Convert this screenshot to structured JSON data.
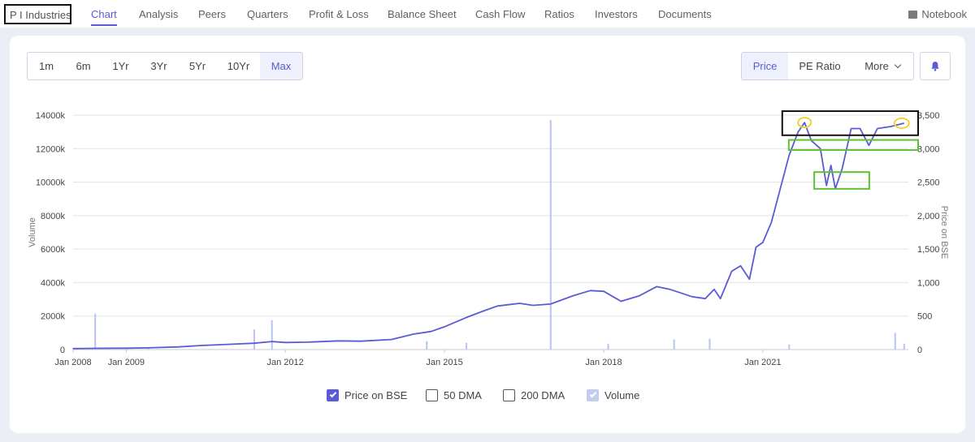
{
  "nav": {
    "company": "P I Industries",
    "items": [
      "Chart",
      "Analysis",
      "Peers",
      "Quarters",
      "Profit & Loss",
      "Balance Sheet",
      "Cash Flow",
      "Ratios",
      "Investors",
      "Documents"
    ],
    "active": "Chart",
    "notebook": "Notebook"
  },
  "ranges": {
    "items": [
      "1m",
      "6m",
      "1Yr",
      "3Yr",
      "5Yr",
      "10Yr",
      "Max"
    ],
    "selected": "Max"
  },
  "metrics": {
    "price": "Price",
    "pe": "PE Ratio",
    "more": "More",
    "selected": "Price"
  },
  "icons": {
    "notebook": "book-icon",
    "alert": "bell-icon",
    "dropdown": "chevron-down-icon"
  },
  "colors": {
    "accent": "#5a5bd5",
    "price_line": "#5a5bd5",
    "volume": "#b7c4ef",
    "annotation_box": "#111111",
    "annotation_green": "#5bc236",
    "annotation_circle": "#f0d23a"
  },
  "legend": [
    {
      "label": "Price on BSE",
      "checked": true
    },
    {
      "label": "50 DMA",
      "checked": false
    },
    {
      "label": "200 DMA",
      "checked": false
    },
    {
      "label": "Volume",
      "checked": true
    }
  ],
  "chart_data": {
    "type": "line",
    "title": "",
    "x_tick_labels": [
      "Jan 2008",
      "Jan 2009",
      "Jan 2012",
      "Jan 2015",
      "Jan 2018",
      "Jan 2021"
    ],
    "y_left": {
      "label": "Volume",
      "ticks": [
        "0",
        "2000k",
        "4000k",
        "6000k",
        "8000k",
        "10000k",
        "12000k",
        "14000k"
      ],
      "range": [
        0,
        14000
      ]
    },
    "y_right": {
      "label": "Price on BSE",
      "ticks": [
        "0",
        "500",
        "1,000",
        "1,500",
        "2,000",
        "2,500",
        "3,000",
        "3,500"
      ],
      "range": [
        0,
        3500
      ]
    },
    "grid": true,
    "x_range": [
      "2008-01-01",
      "2023-09-30"
    ],
    "series": [
      {
        "name": "Price on BSE",
        "axis": "right",
        "points": [
          [
            "2008-01-01",
            15
          ],
          [
            "2008-06-01",
            18
          ],
          [
            "2009-01-01",
            20
          ],
          [
            "2009-06-01",
            25
          ],
          [
            "2010-01-01",
            40
          ],
          [
            "2010-06-01",
            60
          ],
          [
            "2011-01-01",
            80
          ],
          [
            "2011-06-01",
            95
          ],
          [
            "2011-10-01",
            120
          ],
          [
            "2012-01-01",
            105
          ],
          [
            "2012-06-01",
            110
          ],
          [
            "2013-01-01",
            130
          ],
          [
            "2013-06-01",
            125
          ],
          [
            "2014-01-01",
            150
          ],
          [
            "2014-06-01",
            230
          ],
          [
            "2014-10-01",
            270
          ],
          [
            "2015-01-01",
            340
          ],
          [
            "2015-06-01",
            480
          ],
          [
            "2015-10-01",
            580
          ],
          [
            "2016-01-01",
            650
          ],
          [
            "2016-06-01",
            690
          ],
          [
            "2016-09-01",
            660
          ],
          [
            "2017-01-01",
            680
          ],
          [
            "2017-06-01",
            800
          ],
          [
            "2017-10-01",
            880
          ],
          [
            "2018-01-01",
            870
          ],
          [
            "2018-05-01",
            720
          ],
          [
            "2018-09-01",
            800
          ],
          [
            "2019-01-01",
            940
          ],
          [
            "2019-04-01",
            900
          ],
          [
            "2019-09-01",
            790
          ],
          [
            "2019-12-01",
            760
          ],
          [
            "2020-02-01",
            900
          ],
          [
            "2020-03-15",
            760
          ],
          [
            "2020-06-01",
            1170
          ],
          [
            "2020-08-01",
            1250
          ],
          [
            "2020-10-01",
            1050
          ],
          [
            "2020-11-15",
            1530
          ],
          [
            "2021-01-01",
            1600
          ],
          [
            "2021-03-01",
            1900
          ],
          [
            "2021-05-01",
            2400
          ],
          [
            "2021-07-01",
            2900
          ],
          [
            "2021-09-01",
            3250
          ],
          [
            "2021-10-15",
            3390
          ],
          [
            "2021-12-01",
            3120
          ],
          [
            "2022-02-01",
            3000
          ],
          [
            "2022-03-15",
            2450
          ],
          [
            "2022-04-15",
            2750
          ],
          [
            "2022-05-15",
            2400
          ],
          [
            "2022-07-01",
            2700
          ],
          [
            "2022-09-01",
            3300
          ],
          [
            "2022-11-01",
            3300
          ],
          [
            "2023-01-01",
            3050
          ],
          [
            "2023-03-01",
            3300
          ],
          [
            "2023-06-01",
            3330
          ],
          [
            "2023-09-01",
            3380
          ]
        ]
      },
      {
        "name": "Volume",
        "axis": "left",
        "points": [
          [
            "2008-01-01",
            100
          ],
          [
            "2008-06-01",
            2150
          ],
          [
            "2009-06-01",
            150
          ],
          [
            "2011-06-01",
            1200
          ],
          [
            "2011-10-01",
            1750
          ],
          [
            "2014-09-01",
            500
          ],
          [
            "2015-06-01",
            400
          ],
          [
            "2017-01-01",
            13700
          ],
          [
            "2018-02-01",
            350
          ],
          [
            "2019-05-01",
            600
          ],
          [
            "2020-01-01",
            650
          ],
          [
            "2021-07-01",
            300
          ],
          [
            "2023-07-01",
            1000
          ],
          [
            "2023-09-01",
            350
          ]
        ]
      }
    ],
    "annotations": [
      "black box around the recent highs",
      "green boxes around support zones",
      "yellow circles on the two peaks"
    ]
  }
}
